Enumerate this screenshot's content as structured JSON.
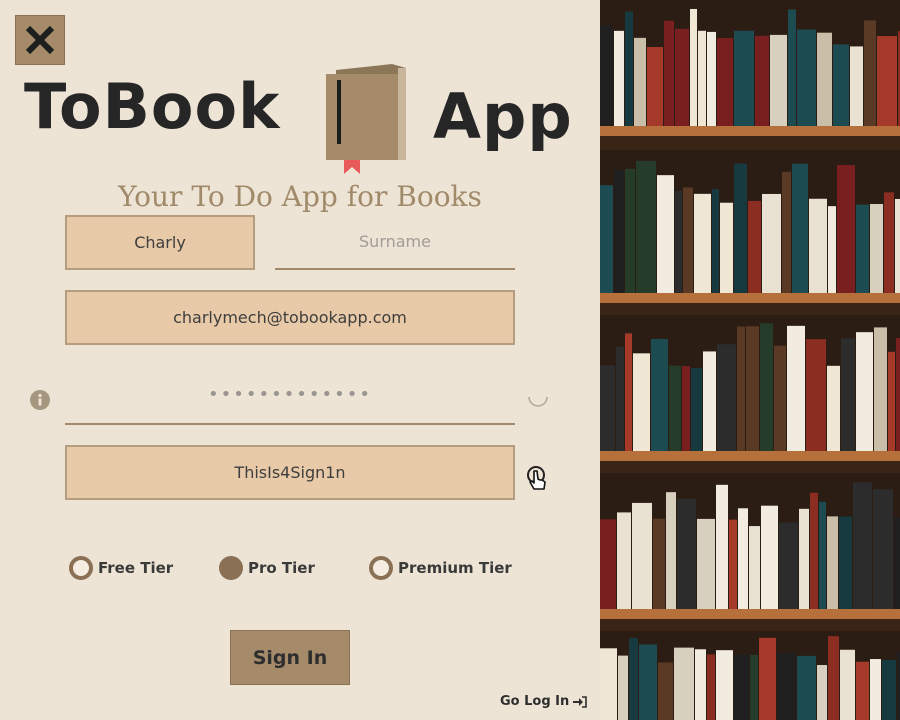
{
  "app": {
    "logo_left": "ToBook",
    "logo_right": "App",
    "subtitle": "Your To Do App for Books"
  },
  "form": {
    "name_value": "Charly",
    "surname_placeholder": "Surname",
    "email_value": "charlymech@tobookapp.com",
    "password_mask": "•••••••••••••",
    "confirm_value": "ThisIs4Sign1n"
  },
  "tiers": {
    "free_label": "Free Tier",
    "pro_label": "Pro Tier",
    "premium_label": "Premium Tier",
    "selected": "Pro Tier"
  },
  "actions": {
    "signin_label": "Sign In",
    "login_link_label": "Go Log In"
  },
  "icons": {
    "close": "close-icon",
    "logo": "book-icon",
    "info": "info-icon",
    "loading": "spinner-icon",
    "cursor": "hand-cursor-icon",
    "login": "sign-in-arrow-icon"
  },
  "colors": {
    "background": "#eee4d6",
    "accent": "#a58b6a",
    "field_fill": "#e8c9a8",
    "radio": "#8a7156",
    "bookmark": "#e8595a"
  }
}
